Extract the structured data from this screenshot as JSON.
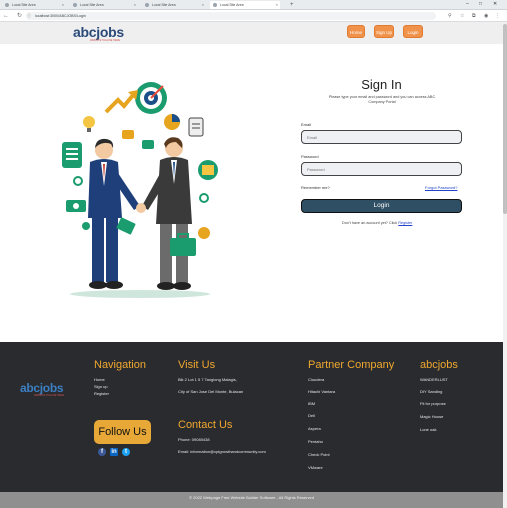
{
  "browser": {
    "tabs": [
      {
        "label": "Local Site Area",
        "active": false
      },
      {
        "label": "Local Site Area",
        "active": false
      },
      {
        "label": "Local Site Area",
        "active": false
      },
      {
        "label": "Local Site Area",
        "active": true
      }
    ],
    "url": "localhost:3000/ABCJOBS/Login"
  },
  "header": {
    "logo_main": "abcjobs",
    "logo_tag": "WEBSITE TAGLINE HERE",
    "buttons": [
      "Home",
      "Sign Up",
      "Login"
    ]
  },
  "signin": {
    "title": "Sign In",
    "subtitle": "Please type your email and password and you can access ABC Company Portal",
    "email_label": "Email",
    "email_placeholder": "Email",
    "password_label": "Password",
    "password_placeholder": "Password",
    "remember_label": "Remember me?",
    "forgot_label": "Forgot Password?",
    "login_label": "Login",
    "no_account_text": "Don't have an account yet? Click",
    "register_label": "Register"
  },
  "footer": {
    "logo_main": "abcjobs",
    "logo_tag": "WEBSITE TAGLINE HERE",
    "navigation": {
      "title": "Navigation",
      "items": [
        "Home",
        "Sign up",
        "Register"
      ]
    },
    "visit": {
      "title": "Visit Us",
      "address1": "Blk 2 Lot 1 5 7 Tanglong Malagis,",
      "address2": "City of San Jose Del Monte, Bulacan"
    },
    "contact": {
      "title": "Contact Us",
      "phone": "Phone: 09080438",
      "email": "Email: information@cptgrowthandcommunity.com"
    },
    "partner": {
      "title": "Partner Company",
      "items": [
        "Cloudera",
        "Hitachi Vantara",
        "IBM",
        "Dell",
        "Aspera",
        "Pentaho",
        "Check Point",
        "VMware"
      ]
    },
    "abcjobs": {
      "title": "abcjobs",
      "items": [
        "WANDERLUST",
        "DIY Sanding",
        "Fit for purpose",
        "Magic House",
        "Lone oak"
      ]
    },
    "follow_label": "Follow Us",
    "copyright": "© 2022 Webpage Free Website Builder Software - All Rights Reserved"
  },
  "colors": {
    "accent_orange": "#f0924a",
    "footer_bg": "#2a2b2e",
    "footer_title": "#f0a830",
    "login_button": "#2f4f65",
    "follow_bg": "#e8a838"
  }
}
